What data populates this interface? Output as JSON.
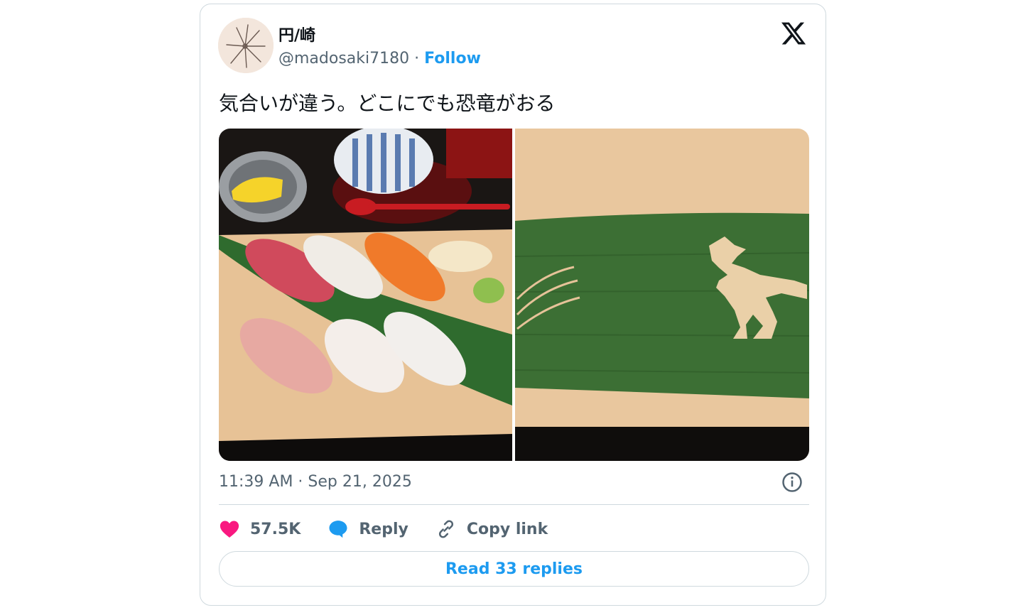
{
  "author": {
    "display_name": "円/崎",
    "handle": "@madosaki7180",
    "separator": "·",
    "follow_label": "Follow"
  },
  "tweet": {
    "text": "気合いが違う。どこにでも恐竜がおる",
    "timestamp": "11:39 AM · Sep 21, 2025"
  },
  "media": {
    "images": [
      {
        "icon": "sushi-platter-photo"
      },
      {
        "icon": "bamboo-leaf-dinosaur-photo"
      }
    ]
  },
  "actions": {
    "like_count": "57.5K",
    "reply_label": "Reply",
    "copy_link_label": "Copy link"
  },
  "footer": {
    "read_replies_label": "Read 33 replies"
  },
  "colors": {
    "accent": "#1d9bf0",
    "like": "#f91880",
    "text_primary": "#0f1419",
    "text_secondary": "#536471",
    "border": "#cfd9de"
  }
}
